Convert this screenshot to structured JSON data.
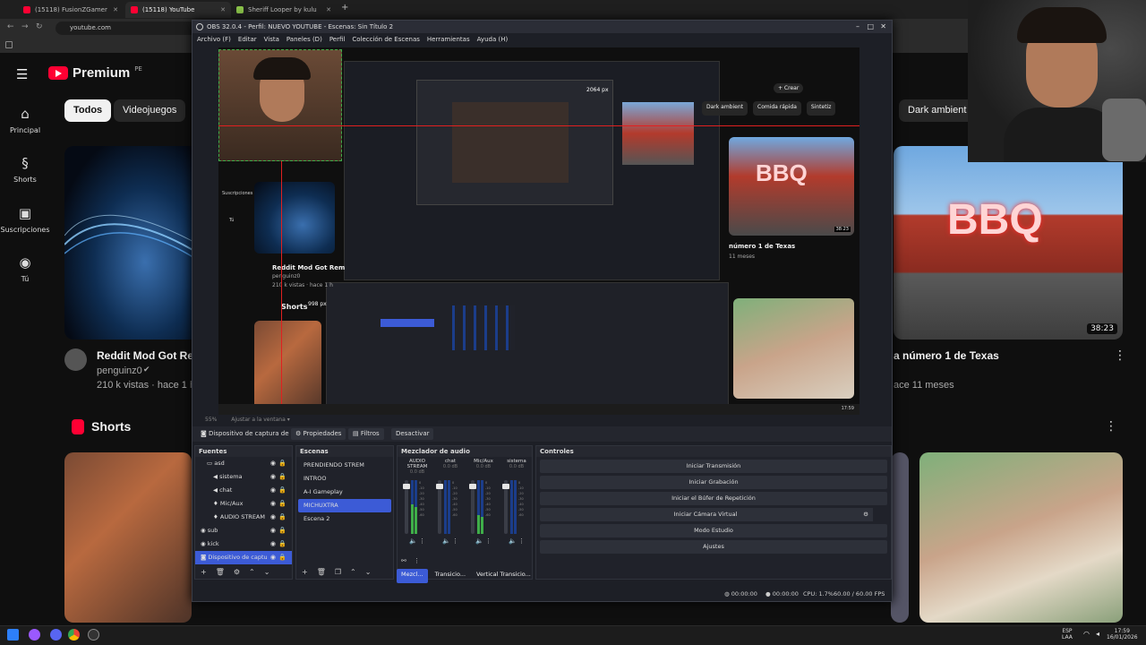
{
  "browser": {
    "tabs": [
      {
        "label": "(15118) FusionZGamer - YouTub",
        "active": false
      },
      {
        "label": "(15118) YouTube",
        "active": true
      },
      {
        "label": "Sheriff Looper by kulu",
        "active": false
      }
    ],
    "new_tab": "+",
    "url": "youtube.com",
    "nav_icons": [
      "back-icon",
      "forward-icon",
      "reload-icon"
    ]
  },
  "youtube": {
    "logo_text": "Premium",
    "logo_region": "PE",
    "sidebar": [
      {
        "label": "Principal",
        "icon": "home-icon"
      },
      {
        "label": "Shorts",
        "icon": "shorts-icon"
      },
      {
        "label": "Suscripciones",
        "icon": "subscriptions-icon"
      },
      {
        "label": "Tú",
        "icon": "user-icon"
      }
    ],
    "chips": [
      {
        "label": "Todos",
        "selected": true
      },
      {
        "label": "Videojuegos",
        "selected": false
      }
    ],
    "right_chip": "Dark ambient",
    "videos": [
      {
        "title": "Reddit Mod Got Rem",
        "channel": "penguinz0",
        "meta": "210 k vistas · hace 1 ho"
      },
      {
        "title": "a número 1 de Texas",
        "duration": "38:23",
        "meta": "ace 11 meses",
        "thumb_text": "BBQ"
      }
    ],
    "shorts_label": "Shorts",
    "accent": "#ff0033"
  },
  "obs": {
    "title": "OBS 32.0.4 - Perfil: NUEVO YOUTUBE - Escenas: Sin Título 2",
    "menu": [
      "Archivo (F)",
      "Editar",
      "Vista",
      "Paneles (D)",
      "Perfil",
      "Colección de Escenas",
      "Herramientas",
      "Ayuda (H)"
    ],
    "preview_overlay": {
      "size_label_1": "2064 px",
      "size_label_2": "998 px",
      "inner_chips": [
        "Dark ambient",
        "Comida rápida",
        "Sintetiz"
      ],
      "crear": "+ Crear",
      "inner_video_title": "Reddit Mod Got Rem",
      "inner_channel": "penguinz0",
      "inner_meta": "210 k vistas · hace 1 h",
      "inner_shorts": "Shorts",
      "inner_bbq_title": "número 1 de Texas",
      "inner_bbq_meta": "11 meses",
      "inner_duration": "38:23",
      "inner_subs": "Suscripciones",
      "inner_tu": "Tú",
      "clock": "17:59"
    },
    "zoom_status": "55%",
    "fit_label": "Ajustar a la ventana",
    "source_toolbar": {
      "source_name": "Dispositivo de captura de v",
      "properties": "Propiedades",
      "filters": "Filtros",
      "deactivate": "Desactivar"
    },
    "docks": {
      "sources_title": "Fuentes",
      "scenes_title": "Escenas",
      "mixer_title": "Mezclador de audio",
      "controls_title": "Controles"
    },
    "sources": [
      {
        "name": "asd",
        "icon": "folder-icon",
        "indent": 1,
        "selected": false
      },
      {
        "name": "sistema",
        "icon": "speaker-icon",
        "indent": 2,
        "selected": false
      },
      {
        "name": "chat",
        "icon": "speaker-icon",
        "indent": 2,
        "selected": false
      },
      {
        "name": "Mic/Aux",
        "icon": "mic-icon",
        "indent": 2,
        "selected": false
      },
      {
        "name": "AUDIO STREAM",
        "icon": "mic-icon",
        "indent": 2,
        "selected": false
      },
      {
        "name": "sub",
        "icon": "globe-icon",
        "indent": 0,
        "selected": false
      },
      {
        "name": "kick",
        "icon": "globe-icon",
        "indent": 0,
        "selected": false
      },
      {
        "name": "Dispositivo de captu",
        "icon": "camera-icon",
        "indent": 0,
        "selected": true
      }
    ],
    "scenes": [
      {
        "name": "PRENDIENDO STREM",
        "selected": false
      },
      {
        "name": "INTROO",
        "selected": false
      },
      {
        "name": "A-I Gameplay",
        "selected": false
      },
      {
        "name": "MICHUXTRA",
        "selected": true
      },
      {
        "name": "Escena 2",
        "selected": false
      }
    ],
    "mixer": [
      {
        "name": "AUDIO STREAM",
        "db": "0.0 dB",
        "level": 0.55,
        "fader": 0.92
      },
      {
        "name": "chat",
        "db": "0.0 dB",
        "level": 0.0,
        "fader": 0.92
      },
      {
        "name": "Mic/Aux",
        "db": "0.0 dB",
        "level": 0.35,
        "fader": 0.92
      },
      {
        "name": "sistema",
        "db": "0.0 dB",
        "level": 0.0,
        "fader": 0.92
      }
    ],
    "mixer_scale": [
      "0",
      "-5",
      "-10",
      "-15",
      "-20",
      "-25",
      "-30",
      "-35",
      "-40",
      "-45",
      "-50",
      "-55",
      "-60"
    ],
    "mixer_tabs": [
      "Mezcl...",
      "Transicio...",
      "Vertical Transicio..."
    ],
    "controls": [
      {
        "label": "Iniciar Transmisión"
      },
      {
        "label": "Iniciar Grabación"
      },
      {
        "label": "Iniciar el Búfer de Repetición"
      },
      {
        "label": "Iniciar Cámara Virtual",
        "has_gear": true
      },
      {
        "label": "Modo Estudio"
      },
      {
        "label": "Ajustes"
      }
    ],
    "status": {
      "stream_time": "00:00:00",
      "rec_time": "00:00:00",
      "cpu": "CPU: 1.7%",
      "fps": "60.00 / 60.00 FPS"
    },
    "accent": "#3c5bd6"
  },
  "taskbar": {
    "lang_top": "ESP",
    "lang_bottom": "LAA",
    "time": "17:59",
    "date": "16/01/2026"
  }
}
